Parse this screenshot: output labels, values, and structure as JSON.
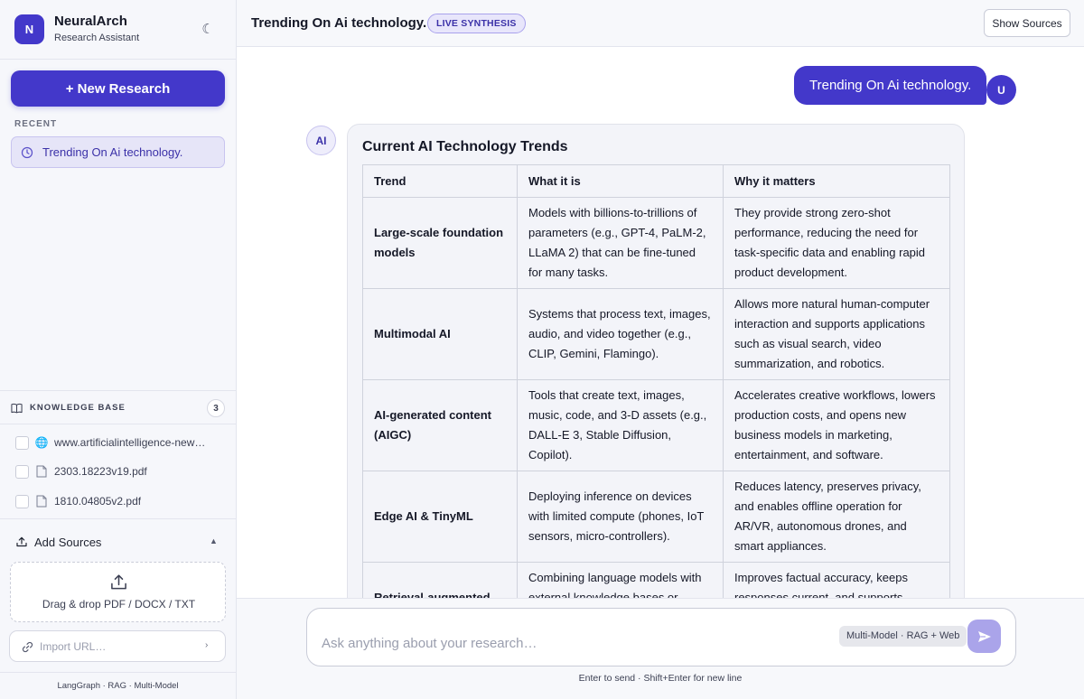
{
  "brand": {
    "logo_letter": "N",
    "name": "NeuralArch",
    "subtitle": "Research Assistant",
    "theme_icon": "moon-icon"
  },
  "sidebar": {
    "new_research_label": "+ New Research",
    "recent_label": "RECENT",
    "recent_items": [
      {
        "label": "Trending On Ai technology.",
        "icon": "clock-icon"
      }
    ],
    "knowledge_base": {
      "title": "KNOWLEDGE BASE",
      "count": "3",
      "items": [
        {
          "name": "www.artificialintelligence-news.…",
          "icon": "globe-icon",
          "checked": false
        },
        {
          "name": "2303.18223v19.pdf",
          "icon": "document-icon",
          "checked": false
        },
        {
          "name": "1810.04805v2.pdf",
          "icon": "document-icon",
          "checked": false
        }
      ]
    },
    "add_sources": {
      "label": "Add Sources",
      "caret": "▲",
      "drop_text": "Drag & drop PDF / DOCX / TXT",
      "import_placeholder": "Import URL…",
      "import_go": "›"
    },
    "footer": "LangGraph · RAG · Multi-Model"
  },
  "header": {
    "title": "Trending On Ai technology.",
    "badge": "LIVE SYNTHESIS",
    "show_sources_label": "Show Sources"
  },
  "chat": {
    "user_message": "Trending On Ai technology.",
    "user_avatar": "U",
    "ai_avatar": "AI",
    "response_title": "Current AI Technology Trends",
    "table": {
      "headers": [
        "Trend",
        "What it is",
        "Why it matters"
      ],
      "rows": [
        [
          "Large-scale foundation models",
          "Models with billions-to-trillions of parameters (e.g., GPT-4, PaLM-2, LLaMA 2) that can be fine-tuned for many tasks.",
          "They provide strong zero-shot performance, reducing the need for task-specific data and enabling rapid product development."
        ],
        [
          "Multimodal AI",
          "Systems that process text, images, audio, and video together (e.g., CLIP, Gemini, Flamingo).",
          "Allows more natural human-computer interaction and supports applications such as visual search, video summarization, and robotics."
        ],
        [
          "AI-generated content (AIGC)",
          "Tools that create text, images, music, code, and 3-D assets (e.g., DALL-E 3, Stable Diffusion, Copilot).",
          "Accelerates creative workflows, lowers production costs, and opens new business models in marketing, entertainment, and software."
        ],
        [
          "Edge AI & TinyML",
          "Deploying inference on devices with limited compute (phones, IoT sensors, micro-controllers).",
          "Reduces latency, preserves privacy, and enables offline operation for AR/VR, autonomous drones, and smart appliances."
        ],
        [
          "Retrieval-augmented",
          "Combining language models with external knowledge bases or search",
          "Improves factual accuracy, keeps responses current, and supports"
        ]
      ]
    }
  },
  "composer": {
    "placeholder": "Ask anything about your research…",
    "mode_label": "Multi-Model · RAG + Web",
    "send_icon": "send-icon",
    "hint": "Enter to send · Shift+Enter for new line"
  },
  "colors": {
    "accent": "#4338ca",
    "accent_light": "#e8e6fb",
    "send_disabled": "#aaa4ea"
  }
}
